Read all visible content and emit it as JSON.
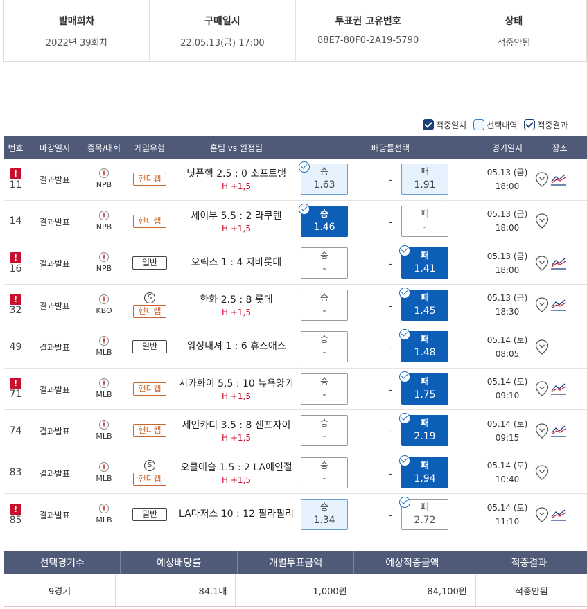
{
  "summary": [
    {
      "label": "발매회차",
      "value": "2022년 39회차"
    },
    {
      "label": "구매일시",
      "value": "22.05.13(금) 17:00"
    },
    {
      "label": "투표권 고유번호",
      "value": "88E7-80F0-2A19-5790"
    },
    {
      "label": "상태",
      "value": "적중안됨"
    }
  ],
  "legend": {
    "hit_match": "적중일치",
    "selection": "선택내역",
    "hit_result": "적중결과"
  },
  "headers": {
    "no": "번호",
    "deadline": "마감일시",
    "sport": "종목/대회",
    "game_type": "게임유형",
    "match": "홈팀 vs 원정팀",
    "odds": "배당률선택",
    "date": "경기일시",
    "place": "장소"
  },
  "rows": [
    {
      "warn": "!",
      "no": "11",
      "deadline": "결과발표",
      "league": "NPB",
      "special": "",
      "type": "핸디캡",
      "match": "닛폰햄 2.5 : 0 소프트뱅",
      "handicap": "H +1,5",
      "home_label": "승",
      "home_odds": "1.63",
      "draw": "-",
      "away_label": "패",
      "away_odds": "1.91",
      "date": "05.13 (금)",
      "time": "18:00"
    },
    {
      "warn": "",
      "no": "14",
      "deadline": "결과발표",
      "league": "NPB",
      "special": "",
      "type": "핸디캡",
      "match": "세이부 5.5 : 2 라쿠텐",
      "handicap": "H +1,5",
      "home_label": "승",
      "home_odds": "1.46",
      "draw": "-",
      "away_label": "패",
      "away_odds": "-",
      "date": "05.13 (금)",
      "time": "18:00"
    },
    {
      "warn": "!",
      "no": "16",
      "deadline": "결과발표",
      "league": "NPB",
      "special": "",
      "type": "일반",
      "match": "오릭스 1 : 4 지바롯데",
      "handicap": "",
      "home_label": "승",
      "home_odds": "-",
      "draw": "-",
      "away_label": "패",
      "away_odds": "1.41",
      "date": "05.13 (금)",
      "time": "18:00"
    },
    {
      "warn": "!",
      "no": "32",
      "deadline": "결과발표",
      "league": "KBO",
      "special": "S",
      "type": "핸디캡",
      "match": "한화 2.5 : 8 롯데",
      "handicap": "H +1,5",
      "home_label": "승",
      "home_odds": "-",
      "draw": "-",
      "away_label": "패",
      "away_odds": "1.45",
      "date": "05.13 (금)",
      "time": "18:30"
    },
    {
      "warn": "",
      "no": "49",
      "deadline": "결과발표",
      "league": "MLB",
      "special": "",
      "type": "일반",
      "match": "워싱내셔 1 : 6 휴스애스",
      "handicap": "",
      "home_label": "승",
      "home_odds": "-",
      "draw": "-",
      "away_label": "패",
      "away_odds": "1.48",
      "date": "05.14 (토)",
      "time": "08:05"
    },
    {
      "warn": "!",
      "no": "71",
      "deadline": "결과발표",
      "league": "MLB",
      "special": "",
      "type": "핸디캡",
      "match": "시카화이 5.5 : 10 뉴욕양키",
      "handicap": "H +1,5",
      "home_label": "승",
      "home_odds": "-",
      "draw": "-",
      "away_label": "패",
      "away_odds": "1.75",
      "date": "05.14 (토)",
      "time": "09:10"
    },
    {
      "warn": "",
      "no": "74",
      "deadline": "결과발표",
      "league": "MLB",
      "special": "",
      "type": "핸디캡",
      "match": "세인카디 3.5 : 8 샌프자이",
      "handicap": "H +1,5",
      "home_label": "승",
      "home_odds": "-",
      "draw": "-",
      "away_label": "패",
      "away_odds": "2.19",
      "date": "05.14 (토)",
      "time": "09:15"
    },
    {
      "warn": "",
      "no": "83",
      "deadline": "결과발표",
      "league": "MLB",
      "special": "S",
      "type": "핸디캡",
      "match": "오클애슬 1.5 : 2 LA에인절",
      "handicap": "H +1,5",
      "home_label": "승",
      "home_odds": "-",
      "draw": "-",
      "away_label": "패",
      "away_odds": "1.94",
      "date": "05.14 (토)",
      "time": "10:40"
    },
    {
      "warn": "!",
      "no": "85",
      "deadline": "결과발표",
      "league": "MLB",
      "special": "",
      "type": "일반",
      "match": "LA다저스 10 : 12 필라필리",
      "handicap": "",
      "home_label": "승",
      "home_odds": "1.34",
      "draw": "-",
      "away_label": "패",
      "away_odds": "2.72",
      "date": "05.14 (토)",
      "time": "11:10"
    }
  ],
  "bottom": {
    "headers": [
      "선택경기수",
      "예상배당률",
      "개별투표금액",
      "예상적중금액",
      "적중결과"
    ],
    "values": [
      "9경기",
      "84.1배",
      "1,000원",
      "84,100원",
      "적중안됨"
    ]
  }
}
